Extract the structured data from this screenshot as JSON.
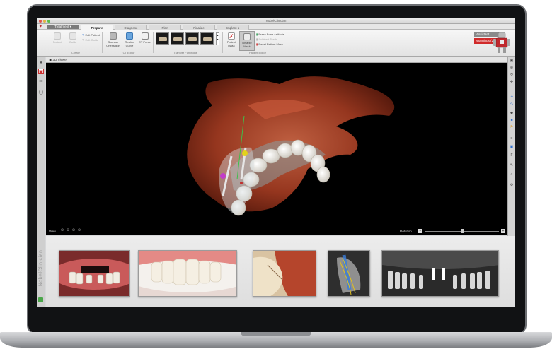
{
  "window": {
    "title": "NobelClinician"
  },
  "mode": {
    "label": "Treatment"
  },
  "tabs": [
    {
      "label": "Prepare",
      "active": true
    },
    {
      "label": "Diagnose",
      "active": false
    },
    {
      "label": "Plan",
      "active": false
    },
    {
      "label": "Finalize",
      "active": false
    },
    {
      "label": "Implant 1",
      "active": false
    }
  ],
  "ribbon": {
    "create": {
      "caption": "Create",
      "patient": "Patient",
      "guide": "Guide",
      "edit_patient": "Edit Patient",
      "edit_guide": "Edit Guide"
    },
    "ct_editor": {
      "caption": "CT Editor",
      "scanner_orientation": "Scanner Orientation",
      "reslice_curve": "Reslice Curve",
      "ct_preset": "CT Preset"
    },
    "transfer": {
      "caption": "Transfer Functions"
    },
    "patient_editor": {
      "caption": "Patient Editor",
      "patient_mask": "Patient Mask",
      "disable_mask": "Disable Mask",
      "erase_bone": "Erase Bone Artifacts",
      "subtract_teeth": "Subtract Teeth",
      "reset_mask": "Reset Patient Mask"
    },
    "assistant": "Assistant",
    "warnings": "Warnings (2)"
  },
  "viewer": {
    "title": "3D Viewer",
    "view_label": "View",
    "rotation_label": "Rotation",
    "rotation_value": 0.5
  },
  "brand": "NobelClinician",
  "colors": {
    "accent_red": "#d02a2a",
    "tab_active": "#f4f4f4",
    "viewer_bg": "#000000",
    "bone": "#b2452a",
    "teeth": "#f2efe8"
  },
  "icons": {
    "left": [
      "patient-icon",
      "scan-icon",
      "cart-icon",
      "chat-icon"
    ],
    "right": [
      "view-icon",
      "zoom-icon",
      "rotate-icon",
      "undo-icon",
      "redo-icon",
      "measure-icon",
      "layer-icon",
      "ruler-icon",
      "pen-icon",
      "settings-icon"
    ]
  }
}
